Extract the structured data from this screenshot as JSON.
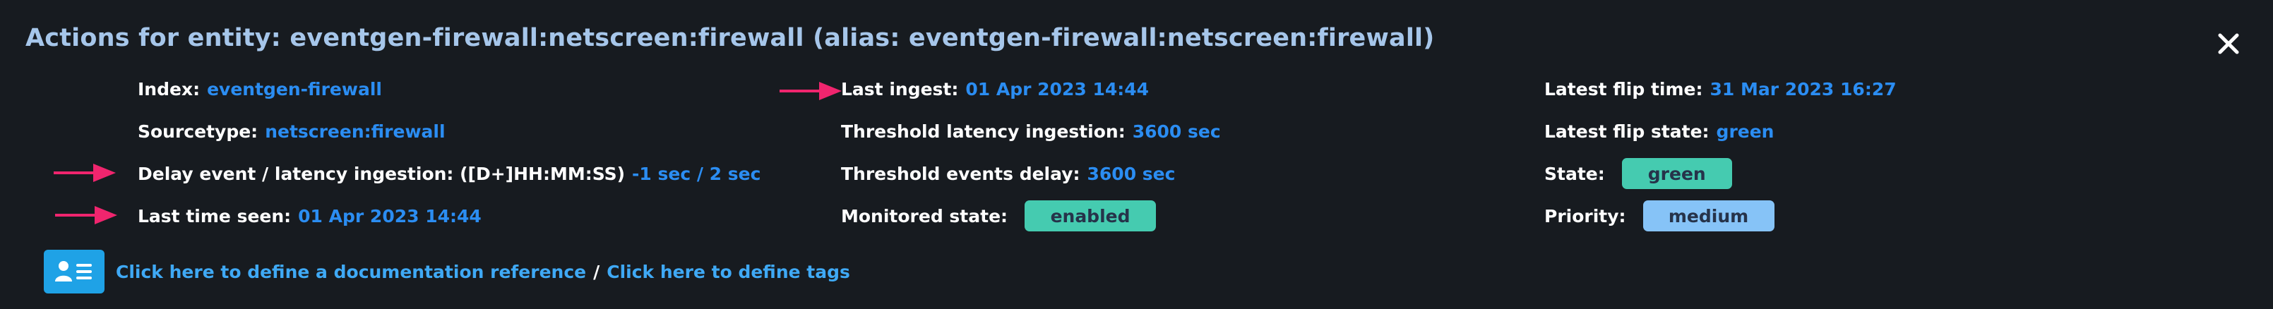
{
  "header": {
    "title": "Actions for entity: eventgen-firewall:netscreen:firewall (alias: eventgen-firewall:netscreen:firewall)"
  },
  "details": {
    "index": {
      "label": "Index:",
      "value": "eventgen-firewall"
    },
    "sourcetype": {
      "label": "Sourcetype:",
      "value": "netscreen:firewall"
    },
    "delay_event": {
      "label": "Delay event / latency ingestion: ([D+]HH:MM:SS)",
      "value": "-1 sec / 2 sec"
    },
    "last_time_seen": {
      "label": "Last time seen:",
      "value": "01 Apr 2023 14:44"
    },
    "last_ingest": {
      "label": "Last ingest:",
      "value": "01 Apr 2023 14:44"
    },
    "threshold_latency": {
      "label": "Threshold latency ingestion:",
      "value": "3600 sec"
    },
    "threshold_events_delay": {
      "label": "Threshold events delay:",
      "value": "3600 sec"
    },
    "monitored_state": {
      "label": "Monitored state:",
      "value": "enabled"
    },
    "latest_flip_time": {
      "label": "Latest flip time:",
      "value": "31 Mar 2023 16:27"
    },
    "latest_flip_state": {
      "label": "Latest flip state:",
      "value": "green"
    },
    "state": {
      "label": "State:",
      "value": "green"
    },
    "priority": {
      "label": "Priority:",
      "value": "medium"
    }
  },
  "links": {
    "documentation": "Click here to define a documentation reference",
    "separator": "/",
    "tags": "Click here to define tags"
  },
  "icons": {
    "close": "close-icon",
    "arrow": "arrow-right-icon",
    "documentation": "id-card-icon"
  },
  "colors": {
    "background": "#171b20",
    "title": "#a6c6ea",
    "value": "#2b8df2",
    "link": "#3fa9f5",
    "arrow": "#f0256e",
    "badge_green": "#45cbb0",
    "badge_blue": "#86c3f7"
  }
}
